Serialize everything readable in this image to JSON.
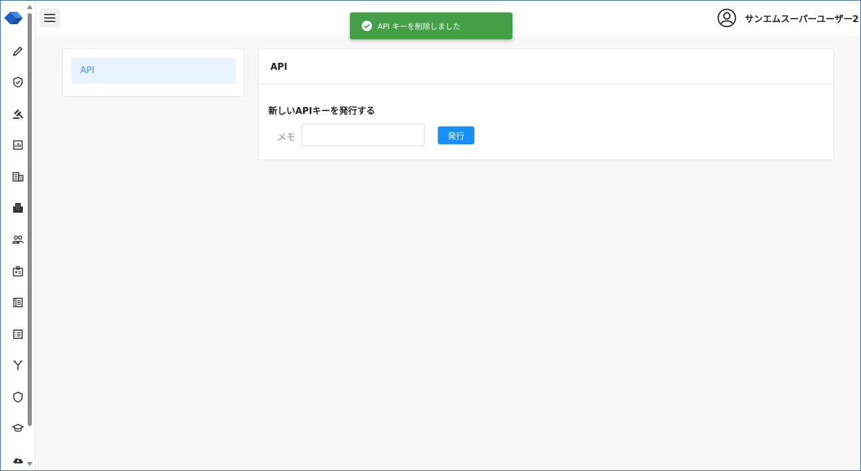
{
  "header": {
    "user_name": "サンエムスーパーユーザー2"
  },
  "toast": {
    "message": "API キーを削除しました",
    "color": "#43a047"
  },
  "sidebar": {
    "icons": [
      "pencil-icon",
      "shield-check-icon",
      "gavel-icon",
      "chart-icon",
      "building-icon",
      "apartment-icon",
      "people-icon",
      "id-badge-icon",
      "contact-book-icon",
      "list-icon",
      "fork-icon",
      "shield-icon",
      "graduation-cap-icon",
      "cloud-upload-icon"
    ]
  },
  "left_panel": {
    "items": [
      {
        "label": "API"
      }
    ]
  },
  "main_panel": {
    "title": "API",
    "section_title": "新しいAPIキーを発行する",
    "memo_label": "メモ",
    "memo_value": "",
    "issue_button": "発行"
  },
  "colors": {
    "accent": "#1890ff",
    "selected_bg": "#e8f3ff",
    "selected_text": "#4a90e2"
  }
}
